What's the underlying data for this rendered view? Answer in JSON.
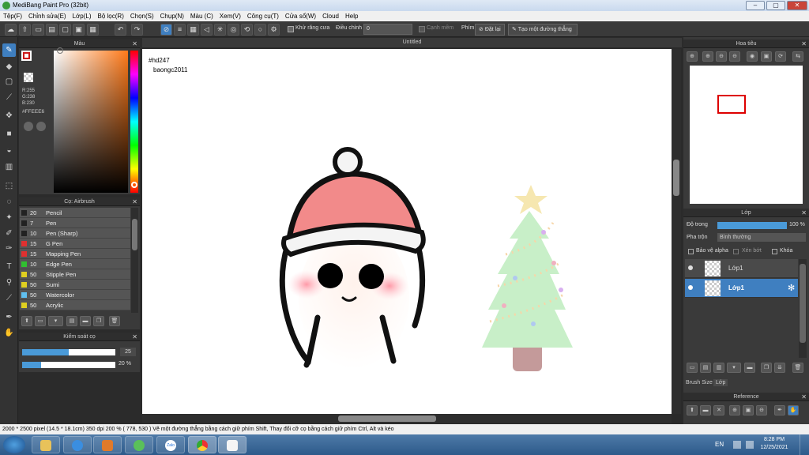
{
  "window": {
    "title": "MediBang Paint Pro (32bit)",
    "minimize": "–",
    "maximize": "▢",
    "close": "✕"
  },
  "menu": [
    "Tệp(F)",
    "Chỉnh sửa(E)",
    "Lớp(L)",
    "Bộ lọc(R)",
    "Chọn(S)",
    "Chụp(N)",
    "Màu (C)",
    "Xem(V)",
    "Công cụ(T)",
    "Cửa sổ(W)",
    "Cloud",
    "Help"
  ],
  "toolbar": {
    "antialias_label": "Khử răng cưa",
    "adjust_label": "Điều chỉnh",
    "adjust_value": "0",
    "edge_label": "Cạnh mềm",
    "key_label": "Phím",
    "reset_label": "Đặt lại",
    "line_label": "Tạo một đường thẳng"
  },
  "color_panel": {
    "title": "Màu",
    "r": "R:255",
    "g": "G:238",
    "b": "B:230",
    "hex": "#FFEEE6",
    "primary_color": "#cc1a1a"
  },
  "brush_panel": {
    "title": "Cọ: Airbrush",
    "items": [
      {
        "size": "20",
        "name": "Pencil",
        "color": "#222222"
      },
      {
        "size": "7",
        "name": "Pen",
        "color": "#222222"
      },
      {
        "size": "10",
        "name": "Pen (Sharp)",
        "color": "#222222"
      },
      {
        "size": "15",
        "name": "G Pen",
        "color": "#e03030"
      },
      {
        "size": "15",
        "name": "Mapping Pen",
        "color": "#e03030"
      },
      {
        "size": "10",
        "name": "Edge Pen",
        "color": "#30c030"
      },
      {
        "size": "50",
        "name": "Stipple Pen",
        "color": "#e0d020"
      },
      {
        "size": "50",
        "name": "Sumi",
        "color": "#e0d020"
      },
      {
        "size": "50",
        "name": "Watercolor",
        "color": "#60c0f0"
      },
      {
        "size": "50",
        "name": "Acrylic",
        "color": "#e0d020"
      }
    ]
  },
  "brush_control": {
    "title": "Kiểm soát cọ",
    "size_value": "25",
    "opacity_value": "20 %",
    "size_fraction": 0.5,
    "opacity_fraction": 0.2
  },
  "canvas": {
    "tab_title": "Untitled",
    "text_line1": "#hd247",
    "text_line2": "baongc2011"
  },
  "navigator": {
    "title": "Hoa tiêu"
  },
  "layer_panel": {
    "title": "Lớp",
    "opacity_label": "Độ trong",
    "opacity_value": "100 %",
    "blend_label": "Pha trộn",
    "blend_value": "Bình thường",
    "protect_alpha": "Bảo vệ alpha",
    "clipping": "Xén bớt",
    "lock": "Khóa",
    "layers": [
      {
        "name": "Lớp1",
        "selected": false
      },
      {
        "name": "Lớp1",
        "selected": true
      }
    ],
    "tab_brush_size": "Brush Size",
    "tab_layer": "Lớp"
  },
  "reference": {
    "title": "Reference"
  },
  "status": {
    "text": "2000 * 2500 pixel   (14.5 * 18.1cm)   350 dpi   200 %   ( 778, 530 )   Vẽ một đường thẳng bằng cách giữ phím Shift, Thay đổi cỡ cọ bằng cách giữ phím Ctrl, Alt và kéo"
  },
  "taskbar": {
    "lang": "EN",
    "time": "8:28 PM",
    "date": "12/25/2021",
    "zalo": "Zalo"
  }
}
